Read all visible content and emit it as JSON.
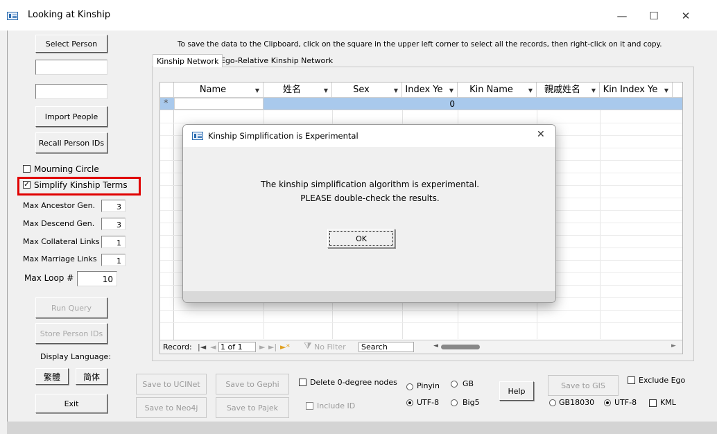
{
  "window": {
    "title": "Looking at Kinship",
    "minimize": "—",
    "maximize": "☐",
    "close": "✕"
  },
  "left_panel": {
    "select_person": "Select Person",
    "import_people": "Import People",
    "recall_person_ids": "Recall Person IDs",
    "mourning_circle": "Mourning Circle",
    "mourning_circle_checked": false,
    "simplify_kinship_terms": "Simplify Kinship Terms",
    "simplify_kinship_terms_checked": true,
    "check_mark": "✓",
    "max_ancestor_label": "Max Ancestor Gen.",
    "max_ancestor_value": "3",
    "max_descend_label": "Max Descend Gen.",
    "max_descend_value": "3",
    "max_collateral_label": "Max Collateral Links",
    "max_collateral_value": "1",
    "max_marriage_label": "Max Marriage Links",
    "max_marriage_value": "1",
    "max_loop_label": "Max Loop #",
    "max_loop_value": "10",
    "run_query": "Run Query",
    "store_person_ids": "Store Person IDs",
    "display_language": "Display Language:",
    "traditional": "繁體",
    "simplified": "简体",
    "exit": "Exit"
  },
  "instruction": "To save the data to the Clipboard, click on the square in the upper left corner to select all the records, then right-click on it and copy.",
  "tabs": [
    {
      "label": "Kinship Network",
      "active": true
    },
    {
      "label": "Ego-Relative Kinship Network",
      "active": false
    }
  ],
  "grid": {
    "columns": [
      "Name",
      "姓名",
      "Sex",
      "Index Ye",
      "Kin Name",
      "親戚姓名",
      "Kin Index Ye"
    ],
    "new_row_marker": "*",
    "new_row_value": "0",
    "record_label": "Record:",
    "record_position": "1 of 1",
    "no_filter": "No Filter",
    "search": "Search"
  },
  "dialog": {
    "title": "Kinship Simplification is Experimental",
    "line1": "The kinship simplification algorithm is experimental.",
    "line2": "PLEASE double-check the results.",
    "ok": "OK",
    "close": "✕"
  },
  "bottom": {
    "save_ucinet": "Save to UCINet",
    "save_gephi": "Save to Gephi",
    "save_neo4j": "Save to Neo4j",
    "save_pajek": "Save to Pajek",
    "delete_zero_degree": "Delete 0-degree nodes",
    "include_id": "Include ID",
    "pinyin": "Pinyin",
    "gb": "GB",
    "utf8": "UTF-8",
    "big5": "Big5",
    "help": "Help",
    "save_gis": "Save to GIS",
    "exclude_ego": "Exclude Ego",
    "gb18030": "GB18030",
    "utf8_gis": "UTF-8",
    "kml": "KML"
  }
}
